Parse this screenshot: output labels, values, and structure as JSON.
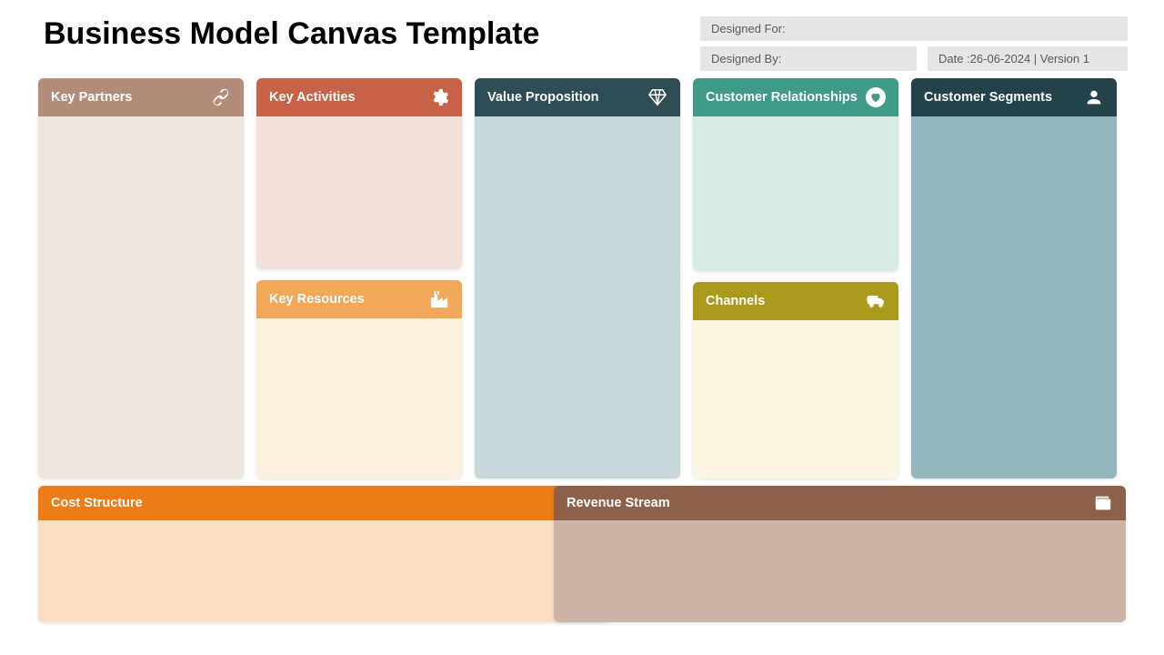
{
  "title": "Business Model Canvas Template",
  "meta": {
    "designed_for_label": "Designed For:",
    "designed_by_label": "Designed By:",
    "date_version": "Date :26-06-2024 | Version 1"
  },
  "blocks": {
    "key_partners": {
      "label": "Key Partners",
      "icon": "link-icon"
    },
    "key_activities": {
      "label": "Key Activities",
      "icon": "gear-icon"
    },
    "key_resources": {
      "label": "Key Resources",
      "icon": "factory-icon"
    },
    "value_proposition": {
      "label": "Value Proposition",
      "icon": "diamond-icon"
    },
    "customer_relationships": {
      "label": "Customer Relationships",
      "icon": "heart-icon"
    },
    "channels": {
      "label": "Channels",
      "icon": "truck-icon"
    },
    "customer_segments": {
      "label": "Customer Segments",
      "icon": "user-icon"
    },
    "cost_structure": {
      "label": "Cost Structure",
      "icon": "tag-icon"
    },
    "revenue_stream": {
      "label": "Revenue Stream",
      "icon": "wallet-icon"
    }
  }
}
